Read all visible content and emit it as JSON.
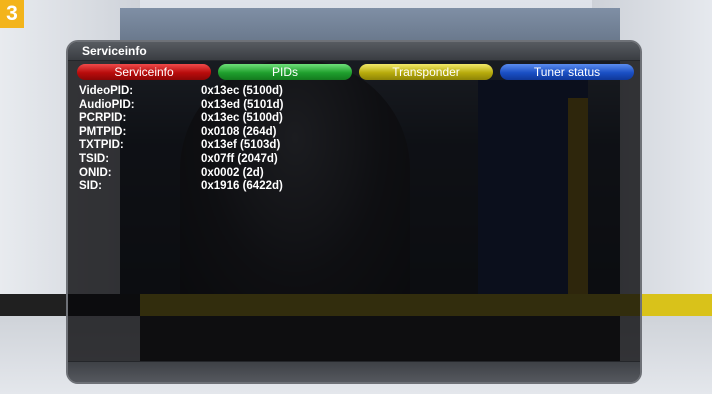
{
  "badge": {
    "number": "3",
    "color": "#f3b41b"
  },
  "window": {
    "title": "Serviceinfo"
  },
  "tabs": [
    {
      "label": "Serviceinfo",
      "color": "#c01010"
    },
    {
      "label": "PIDs",
      "color": "#23a630"
    },
    {
      "label": "Transponder",
      "color": "#bcb00e"
    },
    {
      "label": "Tuner status",
      "color": "#1c52c8"
    }
  ],
  "info": [
    {
      "label": "VideoPID:",
      "value": "0x13ec (5100d)"
    },
    {
      "label": "AudioPID:",
      "value": "0x13ed (5101d)"
    },
    {
      "label": "PCRPID:",
      "value": "0x13ec (5100d)"
    },
    {
      "label": "PMTPID:",
      "value": "0x0108 (264d)"
    },
    {
      "label": "TXTPID:",
      "value": "0x13ef (5103d)"
    },
    {
      "label": "TSID:",
      "value": "0x07ff (2047d)"
    },
    {
      "label": "ONID:",
      "value": "0x0002 (2d)"
    },
    {
      "label": "SID:",
      "value": "0x1916 (6422d)"
    }
  ]
}
